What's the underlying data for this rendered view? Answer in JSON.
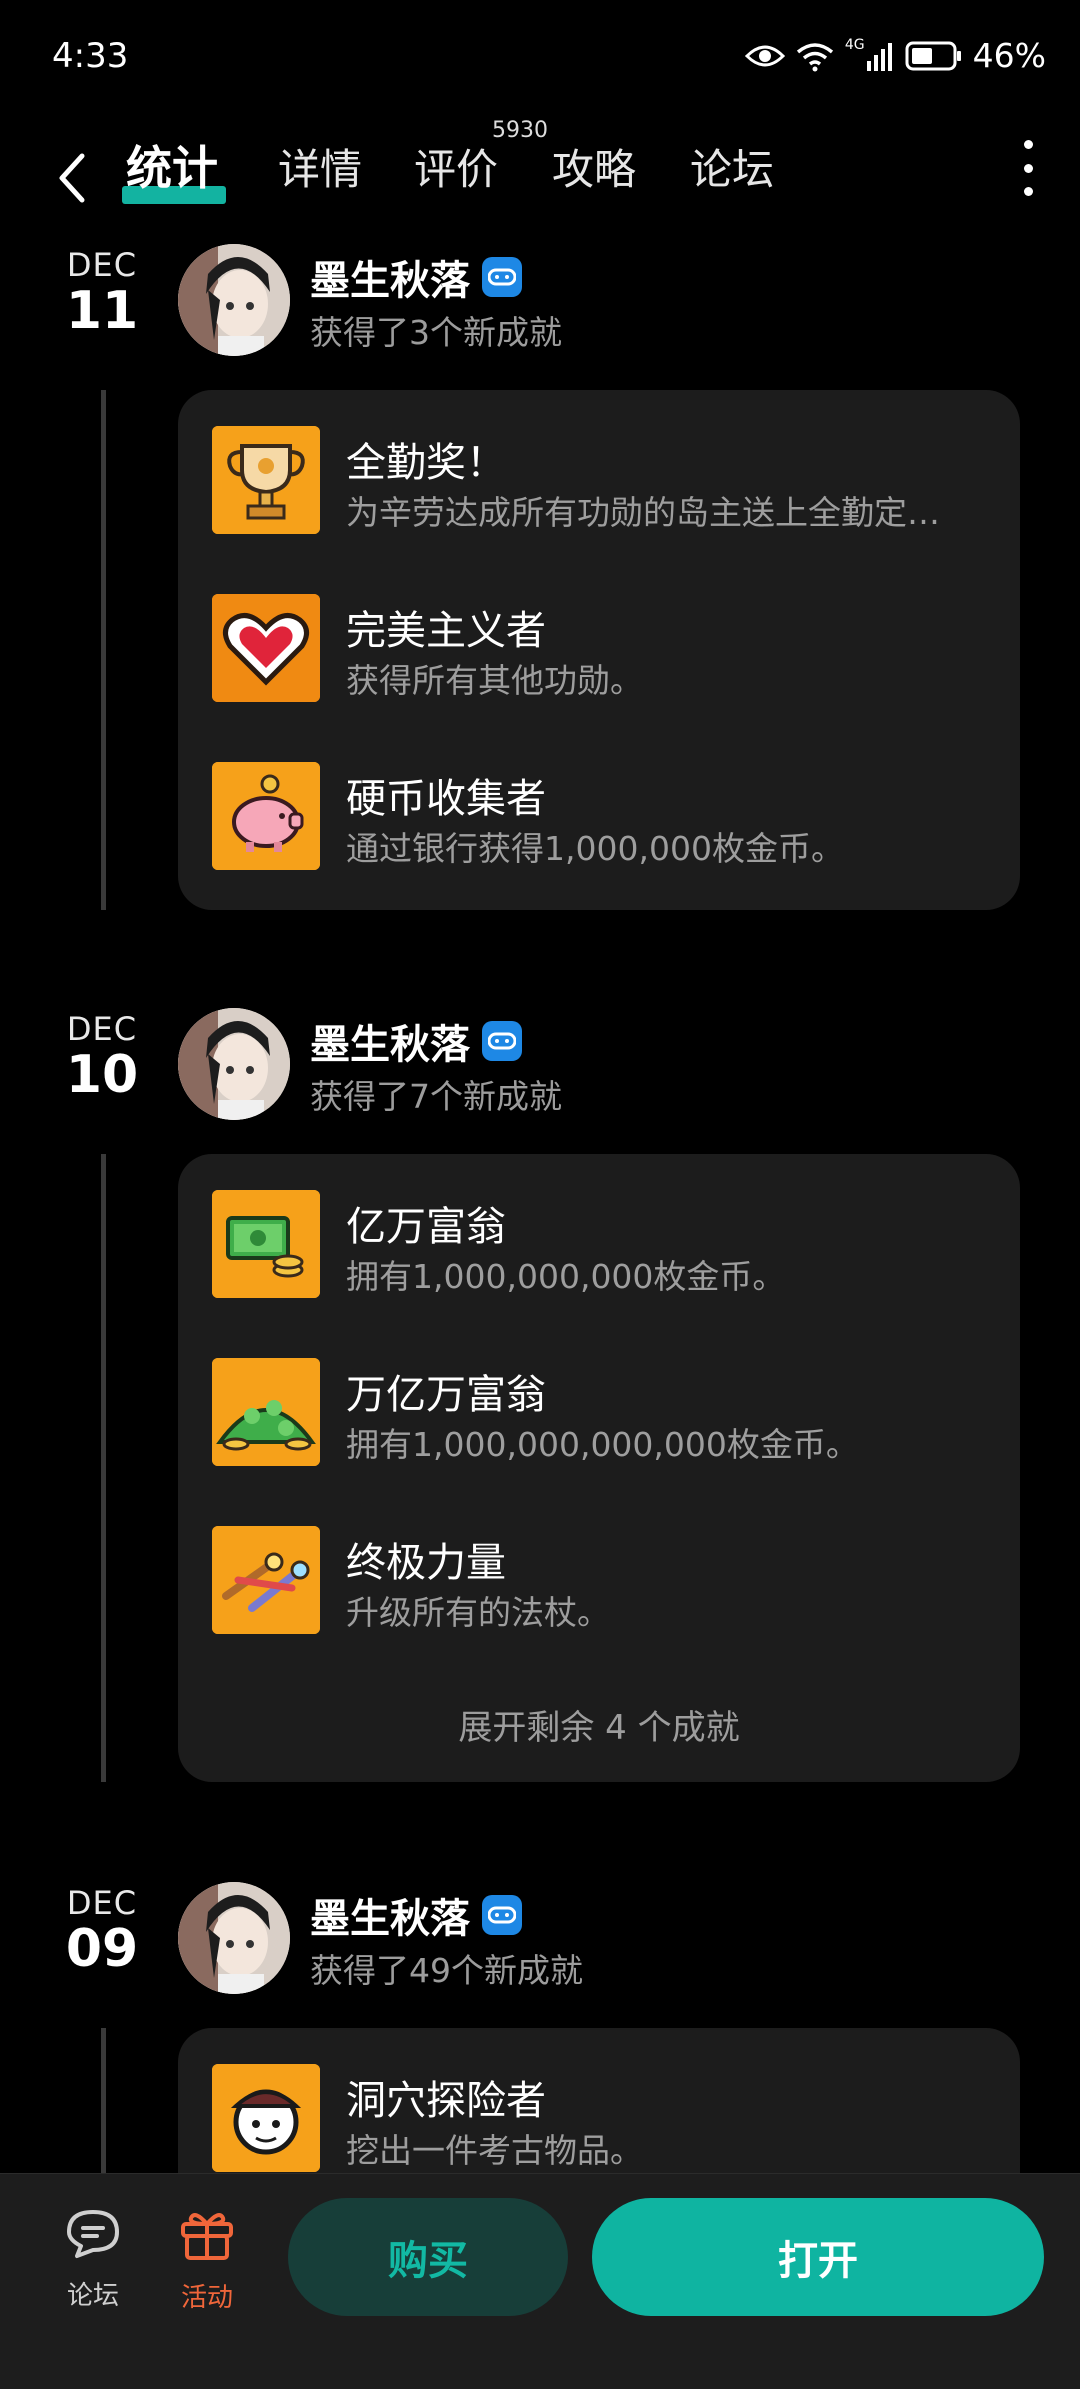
{
  "status_bar": {
    "time": "4:33",
    "network": "4G",
    "battery": "46%"
  },
  "nav": {
    "tabs": [
      {
        "label": "统计",
        "active": true
      },
      {
        "label": "详情"
      },
      {
        "label": "评价"
      },
      {
        "label": "攻略"
      },
      {
        "label": "论坛"
      }
    ],
    "review_count": "5930"
  },
  "groups": [
    {
      "month": "DEC",
      "day": "11",
      "user": "墨生秋落",
      "summary": "获得了3个新成就",
      "achievements": [
        {
          "title": "全勤奖！",
          "desc": "为辛劳达成所有功勋的岛主送上全勤定…",
          "icon": "trophy-icon"
        },
        {
          "title": "完美主义者",
          "desc": "获得所有其他功勋。",
          "icon": "heart-icon"
        },
        {
          "title": "硬币收集者",
          "desc": "通过银行获得1,000,000枚金币。",
          "icon": "piggy-bank-icon"
        }
      ]
    },
    {
      "month": "DEC",
      "day": "10",
      "user": "墨生秋落",
      "summary": "获得了7个新成就",
      "achievements": [
        {
          "title": "亿万富翁",
          "desc": "拥有1,000,000,000枚金币。",
          "icon": "money-stack-icon"
        },
        {
          "title": "万亿万富翁",
          "desc": "拥有1,000,000,000,000枚金币。",
          "icon": "money-pile-icon"
        },
        {
          "title": "终极力量",
          "desc": "升级所有的法杖。",
          "icon": "wands-icon"
        }
      ],
      "expand_label": "展开剩余 4 个成就"
    },
    {
      "month": "DEC",
      "day": "09",
      "user": "墨生秋落",
      "summary": "获得了49个新成就",
      "achievements": [
        {
          "title": "洞穴探险者",
          "desc": "挖出一件考古物品。",
          "icon": "explorer-icon"
        }
      ]
    }
  ],
  "bottom_bar": {
    "forum_label": "论坛",
    "activity_label": "活动",
    "buy_label": "购买",
    "open_label": "打开"
  },
  "colors": {
    "accent": "#13b3a1",
    "activity": "#f0663a",
    "badge": "#1e88e5",
    "icon_bg": "#f7a21b"
  }
}
